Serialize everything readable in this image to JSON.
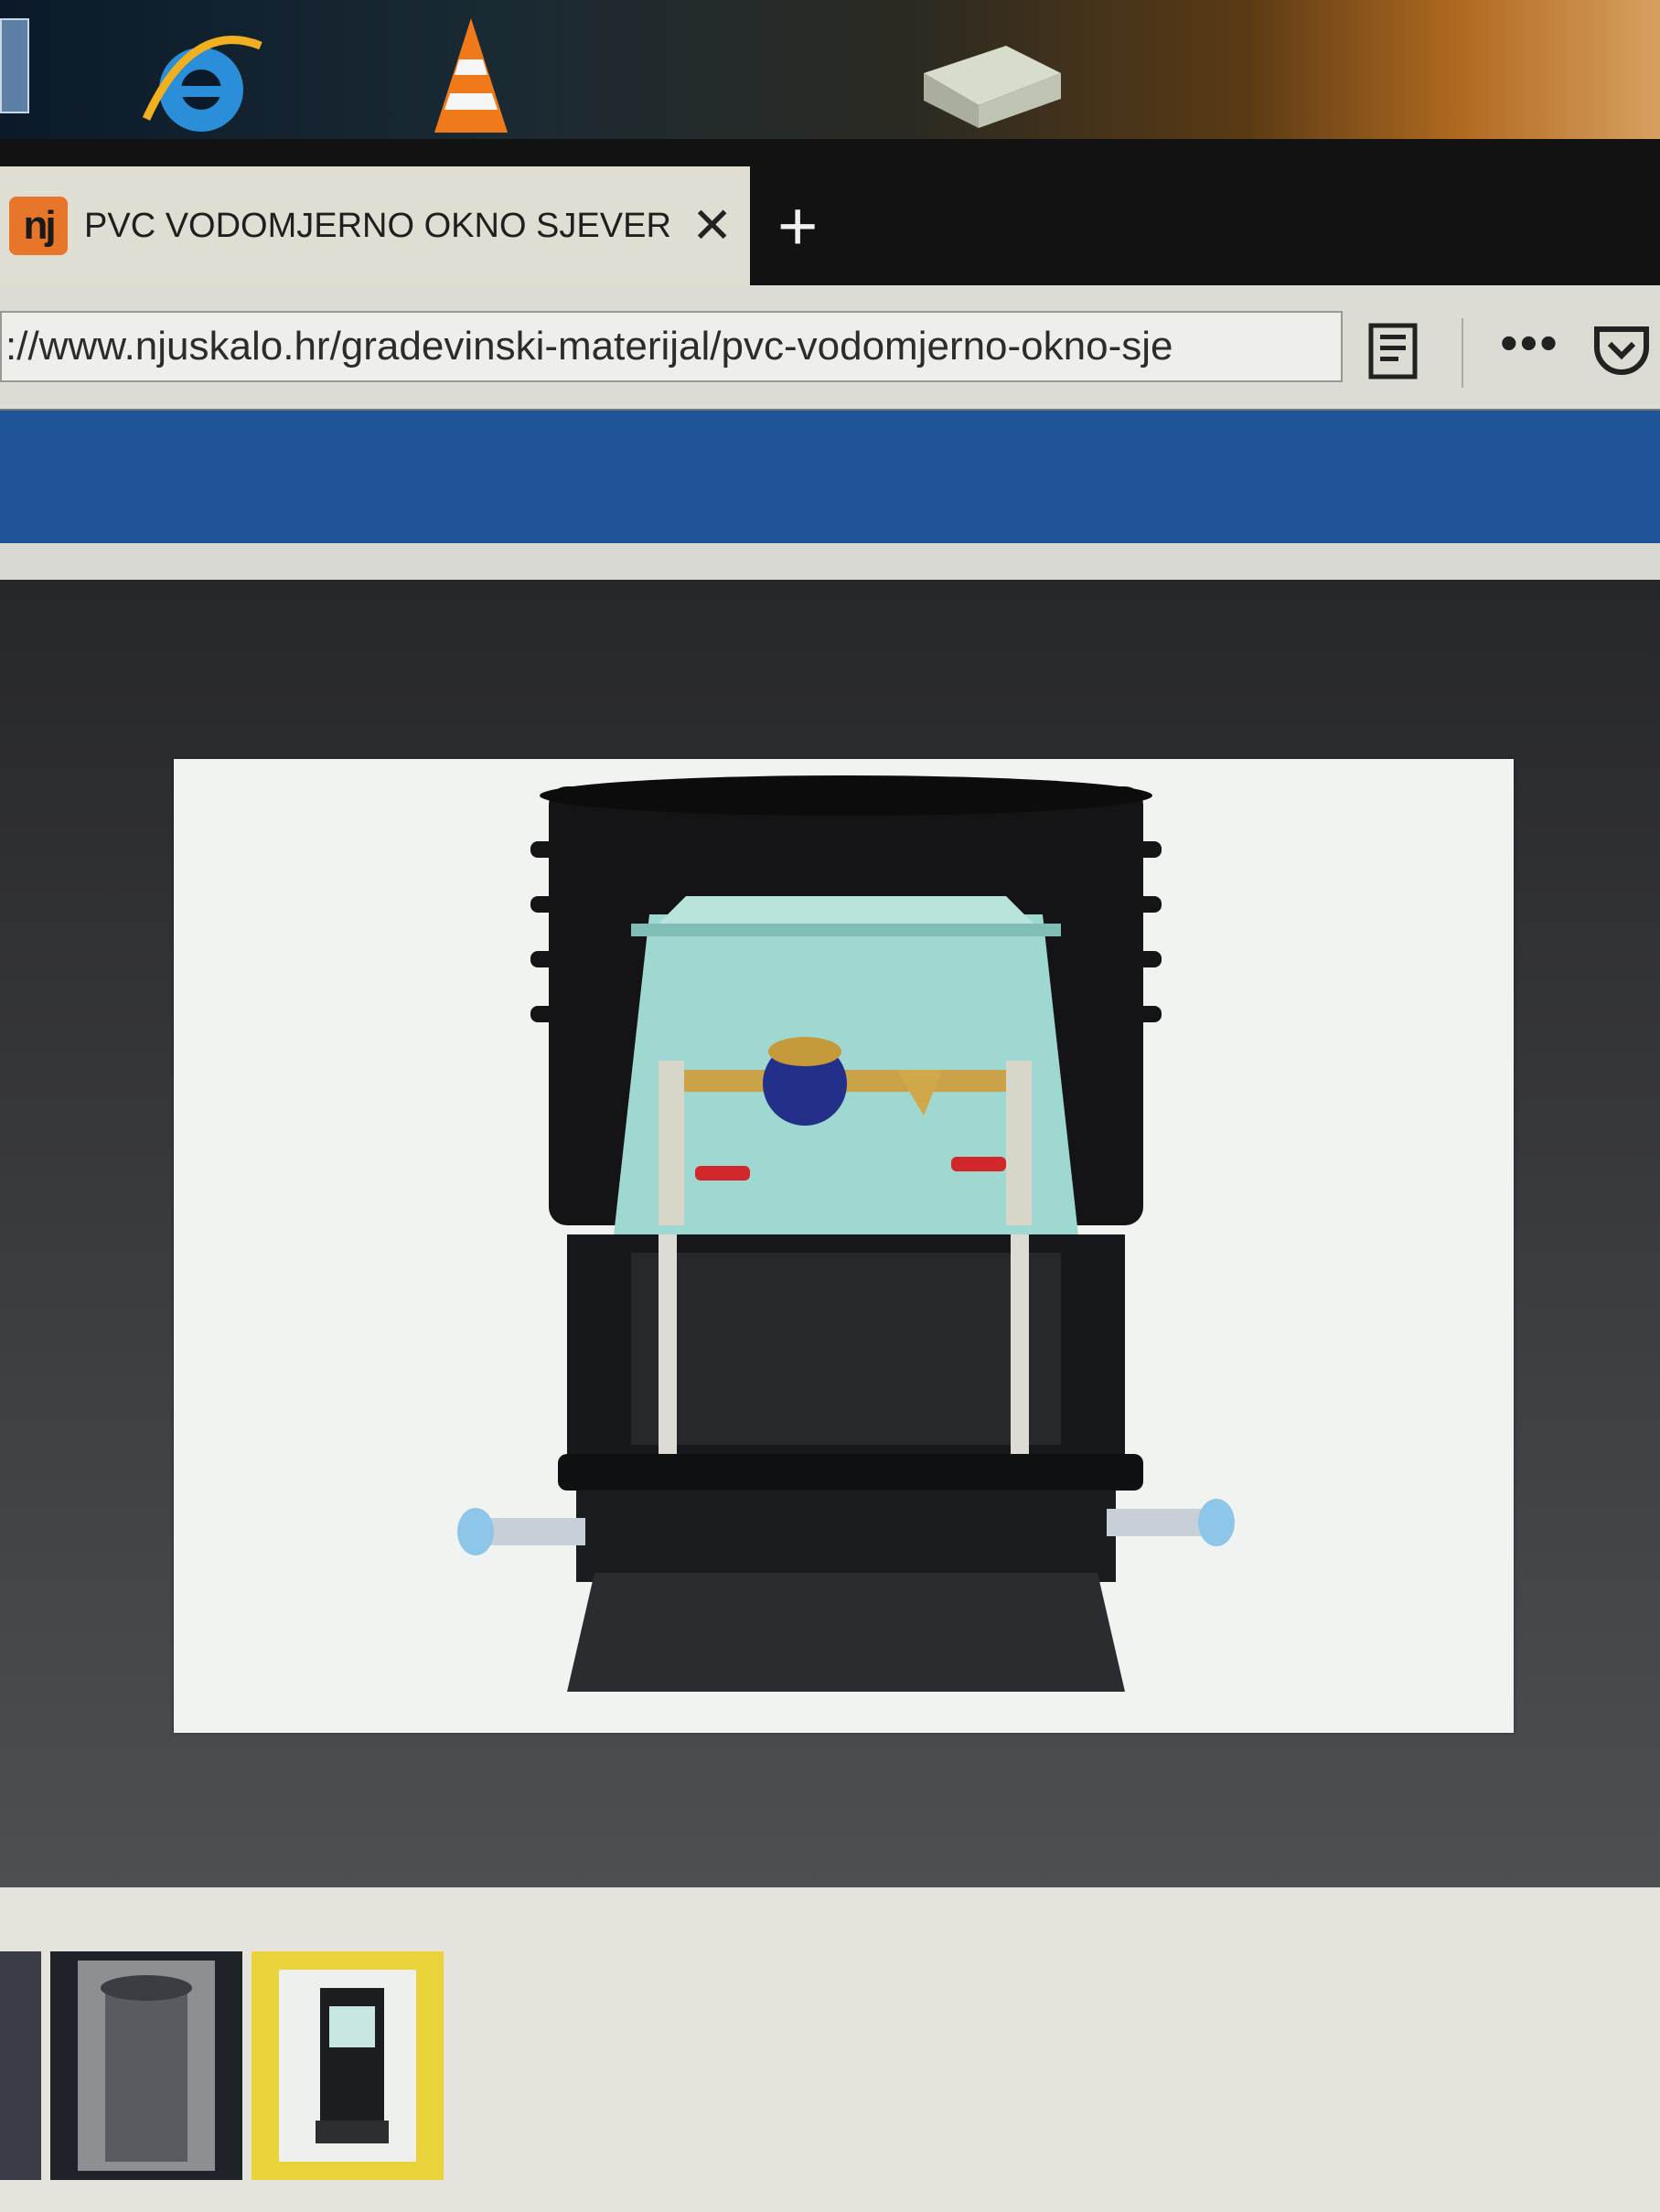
{
  "browser": {
    "tab_title": "PVC VODOMJERNO OKNO SJEVER",
    "favicon_text": "nj",
    "close_glyph": "✕",
    "new_tab_glyph": "+",
    "url": "://www.njuskalo.hr/gradevinski-materijal/pvc-vodomjerno-okno-sje",
    "more_glyph": "•••",
    "icons": [
      "reader-view-icon",
      "more-menu-icon",
      "pocket-icon"
    ]
  },
  "desktop_icons": [
    "folder-icon",
    "internet-explorer-icon",
    "vlc-icon",
    "package-icon"
  ],
  "gallery": {
    "main_image": "water-meter-shaft-photo",
    "thumbnail_count_visible": 3,
    "selected_thumbnail": 3
  },
  "colors": {
    "site_header": "#1f5596",
    "favicon": "#e8762a",
    "selected_thumb_border": "#e9d23a"
  }
}
